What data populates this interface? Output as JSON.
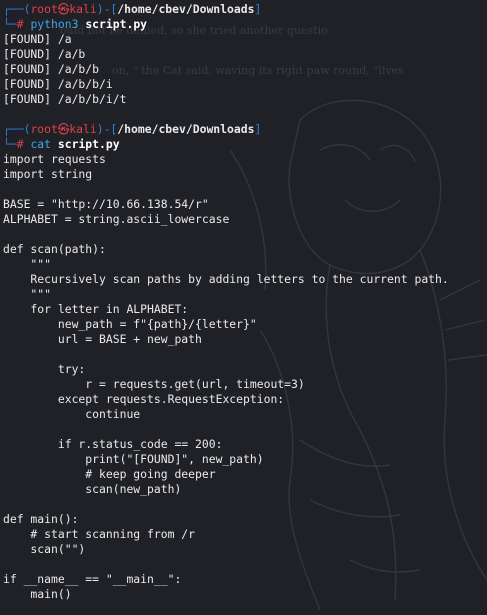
{
  "terminal": {
    "prompt": {
      "user": "root",
      "at_symbol": "㉿",
      "host": "kali",
      "cwd": "/home/cbev/Downloads",
      "hash": "#"
    },
    "session1": {
      "command": "python3",
      "argument": "script.py",
      "output": [
        "[FOUND] /a",
        "[FOUND] /a/b",
        "[FOUND] /a/b/b",
        "[FOUND] /a/b/b/i",
        "[FOUND] /a/b/b/i/t"
      ]
    },
    "session2": {
      "command": "cat",
      "argument": "script.py",
      "file_lines": [
        "import requests",
        "import string",
        "",
        "BASE = \"http://10.66.138.54/r\"",
        "ALPHABET = string.ascii_lowercase",
        "",
        "def scan(path):",
        "    \"\"\"",
        "    Recursively scan paths by adding letters to the current path.",
        "    \"\"\"",
        "    for letter in ALPHABET:",
        "        new_path = f\"{path}/{letter}\"",
        "        url = BASE + new_path",
        "",
        "        try:",
        "            r = requests.get(url, timeout=3)",
        "        except requests.RequestException:",
        "            continue",
        "",
        "        if r.status_code == 200:",
        "            print(\"[FOUND]\", new_path)",
        "            # keep going deeper",
        "            scan(new_path)",
        "",
        "def main():",
        "    # start scanning from /r",
        "    scan(\"\")",
        "",
        "if __name__ == \"__main__\":",
        "    main()"
      ]
    },
    "background_text": {
      "line1": "ould not be denied, so she tried another questio",
      "line2": "on, \" the Cat said, waving its right paw round, \"lives"
    }
  }
}
